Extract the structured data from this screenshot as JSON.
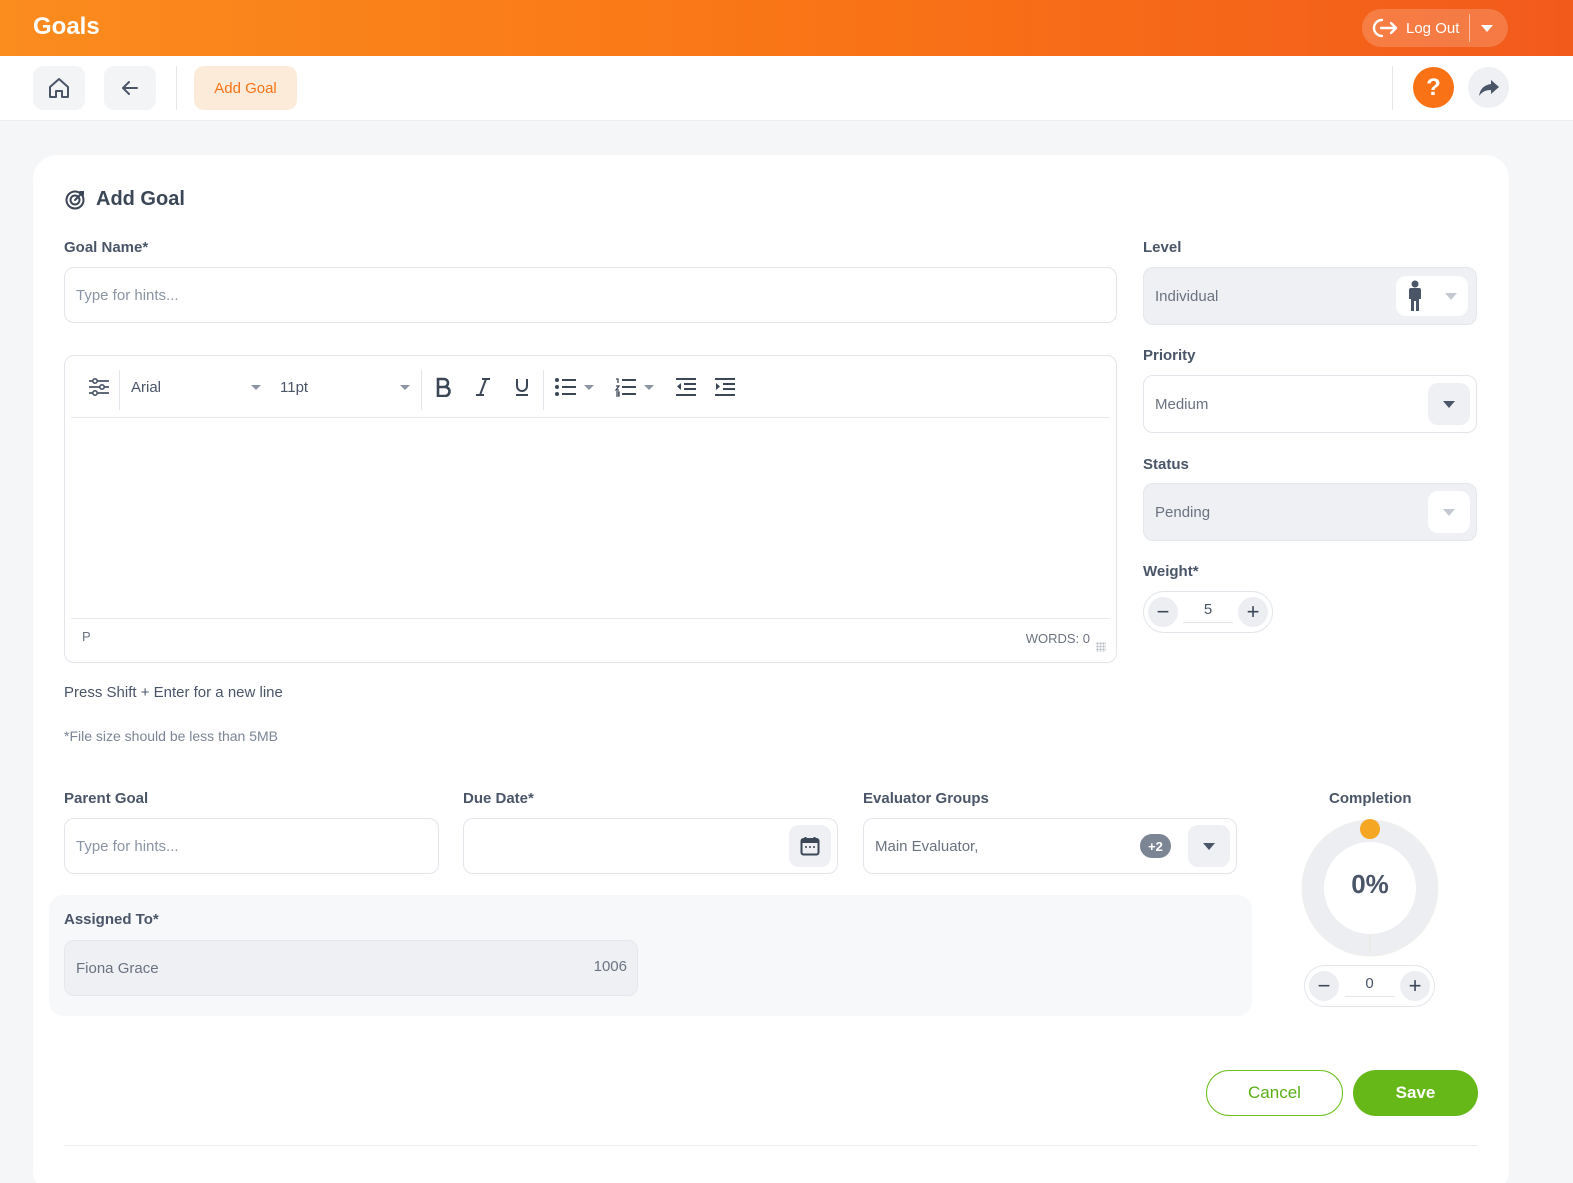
{
  "app": {
    "title": "Goals"
  },
  "header": {
    "logout_label": "Log Out"
  },
  "nav": {
    "breadcrumb": "Add Goal",
    "help_glyph": "?"
  },
  "form": {
    "title": "Add Goal",
    "goal_name": {
      "label": "Goal Name*",
      "placeholder": "Type for hints..."
    },
    "editor": {
      "font": "Arial",
      "size": "11pt",
      "path": "P",
      "words": "WORDS: 0"
    },
    "hint_newline": "Press Shift + Enter for a new line",
    "hint_filesize": "*File size should be less than 5MB",
    "level": {
      "label": "Level",
      "value": "Individual"
    },
    "priority": {
      "label": "Priority",
      "value": "Medium"
    },
    "status": {
      "label": "Status",
      "value": "Pending"
    },
    "weight": {
      "label": "Weight*",
      "value": "5"
    },
    "parent_goal": {
      "label": "Parent Goal",
      "placeholder": "Type for hints..."
    },
    "due_date": {
      "label": "Due Date*",
      "value": ""
    },
    "evaluator_groups": {
      "label": "Evaluator Groups",
      "value": "Main Evaluator,",
      "extra_badge": "+2"
    },
    "completion": {
      "label": "Completion",
      "percent_text": "0%",
      "value": "0",
      "fraction": 0
    },
    "assigned_to": {
      "label": "Assigned To*",
      "name": "Fiona Grace",
      "id": "1006"
    },
    "cancel_label": "Cancel",
    "save_label": "Save"
  },
  "colors": {
    "accent": "#f97316",
    "success": "#66b819"
  }
}
